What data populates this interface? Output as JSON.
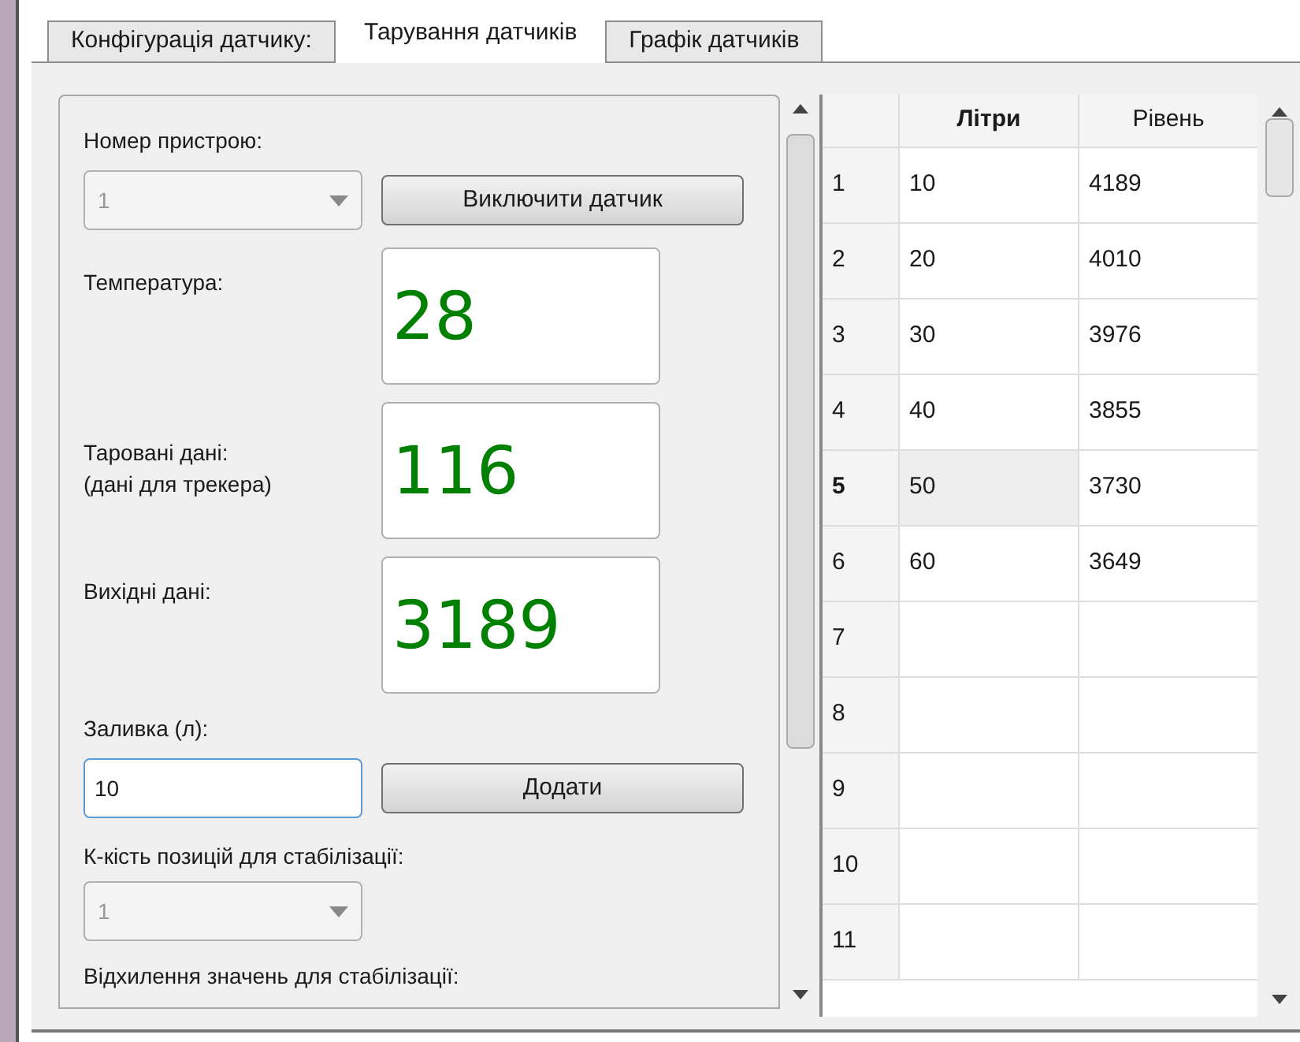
{
  "tabs": [
    {
      "label": "Конфігурація датчику:",
      "selected": false
    },
    {
      "label": "Тарування датчиків",
      "selected": true
    },
    {
      "label": "Графік датчиків",
      "selected": false
    }
  ],
  "form": {
    "device_label": "Номер пристрою:",
    "device_select": {
      "value": "1",
      "disabled": true
    },
    "toggle_button": "Виключити датчик",
    "readouts": [
      {
        "label": [
          "Температура:"
        ],
        "value": "28"
      },
      {
        "label": [
          "Таровані дані:",
          "(дані для трекера)"
        ],
        "value": "116"
      },
      {
        "label": [
          "Вихідні дані:"
        ],
        "value": "3189"
      }
    ],
    "fill_label": "Заливка (л):",
    "fill_input": {
      "value": "10",
      "focused": true
    },
    "add_button": "Додати",
    "stabilization_label": "К-кість позицій для стабілізації:",
    "stabilization_select": {
      "value": "1",
      "disabled": true
    },
    "deviation_label": "Відхилення значень для стабілізації:"
  },
  "table": {
    "columns": [
      "Літри",
      "Рівень"
    ],
    "rows": [
      {
        "header": "1",
        "cells": [
          "10",
          "4189"
        ],
        "current": false
      },
      {
        "header": "2",
        "cells": [
          "20",
          "4010"
        ],
        "current": false
      },
      {
        "header": "3",
        "cells": [
          "30",
          "3976"
        ],
        "current": false
      },
      {
        "header": "4",
        "cells": [
          "40",
          "3855"
        ],
        "current": false
      },
      {
        "header": "5",
        "cells": [
          "50",
          "3730"
        ],
        "current": true
      },
      {
        "header": "6",
        "cells": [
          "60",
          "3649"
        ],
        "current": false
      },
      {
        "header": "7",
        "current": false
      },
      {
        "header": "8",
        "current": false
      },
      {
        "header": "9",
        "current": false
      },
      {
        "header": "10",
        "current": false
      },
      {
        "header": "11",
        "current": false
      }
    ]
  }
}
